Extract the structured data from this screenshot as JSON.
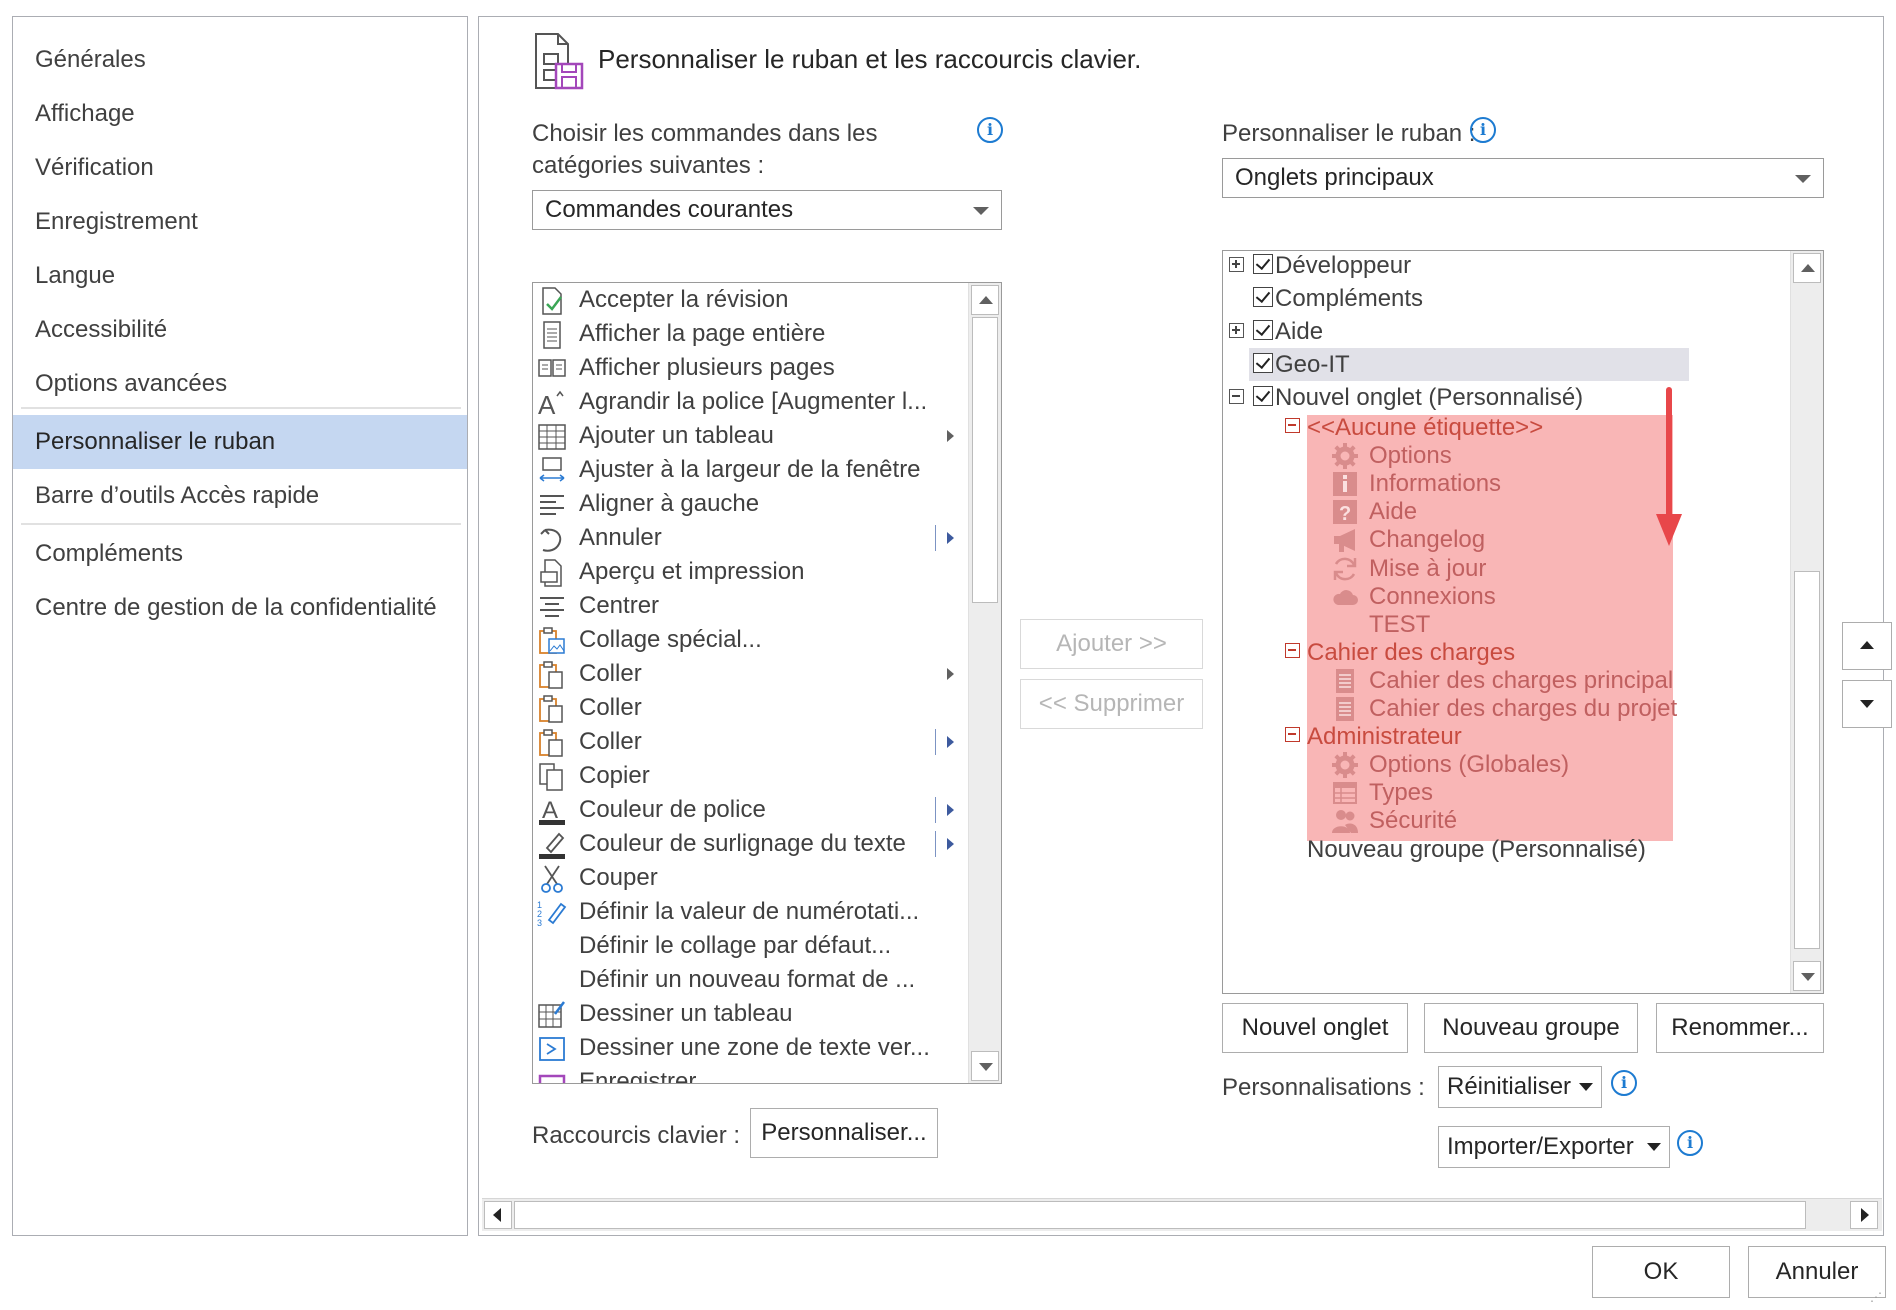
{
  "nav": {
    "items": [
      "Générales",
      "Affichage",
      "Vérification",
      "Enregistrement",
      "Langue",
      "Accessibilité",
      "Options avancées",
      "Personnaliser le ruban",
      "Barre d’outils Accès rapide",
      "Compléments",
      "Centre de gestion de la confidentialité"
    ],
    "selected": "Personnaliser le ruban"
  },
  "header": {
    "title": "Personnaliser le ruban et les raccourcis clavier.",
    "icon": "customize-ribbon-icon"
  },
  "commands": {
    "label_line1": "Choisir les commandes dans les",
    "label_line2": "catégories suivantes :",
    "combo_value": "Commandes courantes",
    "items": [
      {
        "label": "Accepter la révision",
        "icon": "accept-revision-icon"
      },
      {
        "label": "Afficher la page entière",
        "icon": "page-icon"
      },
      {
        "label": "Afficher plusieurs pages",
        "icon": "multi-page-icon"
      },
      {
        "label": "Agrandir la police [Augmenter l...",
        "icon": "grow-font-icon"
      },
      {
        "label": "Ajouter un tableau",
        "icon": "table-icon",
        "submenu": true
      },
      {
        "label": "Ajuster à la largeur de la fenêtre",
        "icon": "fit-width-icon"
      },
      {
        "label": "Aligner à gauche",
        "icon": "align-left-icon"
      },
      {
        "label": "Annuler",
        "icon": "undo-icon",
        "split": true
      },
      {
        "label": "Aperçu et impression",
        "icon": "print-preview-icon"
      },
      {
        "label": "Centrer",
        "icon": "align-center-icon"
      },
      {
        "label": "Collage spécial...",
        "icon": "paste-special-icon"
      },
      {
        "label": "Coller",
        "icon": "paste-icon",
        "submenu": true
      },
      {
        "label": "Coller",
        "icon": "paste-icon"
      },
      {
        "label": "Coller",
        "icon": "paste-icon",
        "split": true
      },
      {
        "label": "Copier",
        "icon": "copy-icon"
      },
      {
        "label": "Couleur de police",
        "icon": "font-color-icon",
        "split": true
      },
      {
        "label": "Couleur de surlignage du texte",
        "icon": "highlight-icon",
        "split": true
      },
      {
        "label": "Couper",
        "icon": "cut-icon"
      },
      {
        "label": "Définir la valeur de numérotati...",
        "icon": "numbering-icon"
      },
      {
        "label": "Définir le collage par défaut...",
        "icon": ""
      },
      {
        "label": "Définir un nouveau format de ...",
        "icon": ""
      },
      {
        "label": "Dessiner un tableau",
        "icon": "draw-table-icon"
      },
      {
        "label": "Dessiner une zone de texte ver...",
        "icon": "text-box-icon"
      },
      {
        "label": "Enregistrer",
        "icon": "save-icon"
      }
    ]
  },
  "buttons": {
    "add": "Ajouter >>",
    "remove": "<< Supprimer",
    "new_tab": "Nouvel onglet",
    "new_group": "Nouveau groupe",
    "rename": "Renommer...",
    "reset": "Réinitialiser",
    "import_export": "Importer/Exporter",
    "customize": "Personnaliser...",
    "ok": "OK",
    "cancel": "Annuler"
  },
  "ribbon": {
    "label": "Personnaliser le ruban :",
    "combo_value": "Onglets principaux",
    "tree": [
      {
        "label": "Développeur",
        "checked": true,
        "expander": "plus"
      },
      {
        "label": "Compléments",
        "checked": true,
        "expander": ""
      },
      {
        "label": "Aide",
        "checked": true,
        "expander": "plus"
      },
      {
        "label": "Geo-IT",
        "checked": true,
        "expander": "",
        "selected": true
      },
      {
        "label": "Nouvel onglet (Personnalisé)",
        "checked": true,
        "expander": "minus"
      }
    ],
    "custom_groups": [
      {
        "label": "<<Aucune étiquette>>",
        "items": [
          {
            "label": "Options",
            "icon": "gear-icon"
          },
          {
            "label": "Informations",
            "icon": "info-icon"
          },
          {
            "label": "Aide",
            "icon": "help-icon"
          },
          {
            "label": "Changelog",
            "icon": "megaphone-icon"
          },
          {
            "label": "Mise à jour",
            "icon": "refresh-icon"
          },
          {
            "label": "Connexions",
            "icon": "cloud-icon"
          },
          {
            "label": "TEST",
            "icon": ""
          }
        ]
      },
      {
        "label": "Cahier des charges",
        "items": [
          {
            "label": "Cahier des charges principal",
            "icon": "document-icon"
          },
          {
            "label": "Cahier des charges du projet",
            "icon": "document-icon"
          }
        ]
      },
      {
        "label": "Administrateur",
        "items": [
          {
            "label": "Options (Globales)",
            "icon": "gear-icon"
          },
          {
            "label": "Types",
            "icon": "table-list-icon"
          },
          {
            "label": "Sécurité",
            "icon": "users-icon"
          }
        ]
      }
    ],
    "trailing": "Nouveau groupe (Personnalisé)"
  },
  "customizations_label": "Personnalisations :",
  "shortcuts_label": "Raccourcis clavier :",
  "colors": {
    "highlight": "#f9b6b6",
    "arrow": "#e8474a",
    "nav_selected": "#c5d7f1",
    "info": "#1d7bd1"
  }
}
